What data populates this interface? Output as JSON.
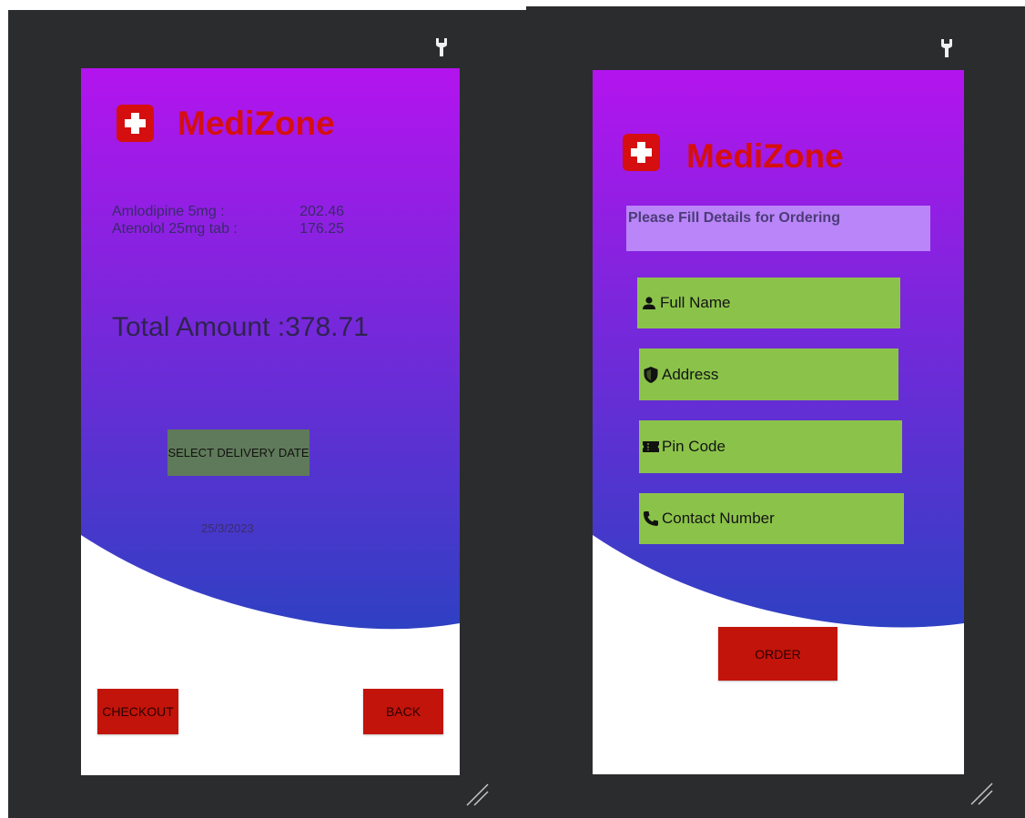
{
  "app": {
    "name": "MediZone"
  },
  "cart_screen": {
    "items": [
      {
        "name": "Amlodipine 5mg :",
        "price": "202.46"
      },
      {
        "name": "Atenolol 25mg tab :",
        "price": "176.25"
      }
    ],
    "total_label": "Total Amount :378.71",
    "delivery_button_label": "SELECT DELIVERY DATE",
    "delivery_date": "25/3/2023",
    "checkout_label": "CHECKOUT",
    "back_label": "BACK"
  },
  "order_screen": {
    "notice": "Please Fill Details for Ordering",
    "fields": {
      "full_name": "Full Name",
      "address": "Address",
      "pin_code": "Pin Code",
      "contact_number": "Contact Number"
    },
    "order_label": "ORDER"
  },
  "icons": {
    "logo": "medical-cross-icon",
    "tool": "wrench-icon",
    "resize": "resize-handle-icon",
    "full_name": "person-icon",
    "address": "shield-icon",
    "pin_code": "ticket-icon",
    "contact_number": "phone-icon"
  },
  "colors": {
    "gradient_top": "#b314ee",
    "gradient_bottom": "#2f40c3",
    "brand_red": "#d50f0f",
    "button_red": "#c2140a",
    "field_green": "#8bc34a",
    "delivery_button": "#5f7a5a",
    "notice_bg": "#b985f8",
    "canvas_dark": "#2b2c2e"
  }
}
